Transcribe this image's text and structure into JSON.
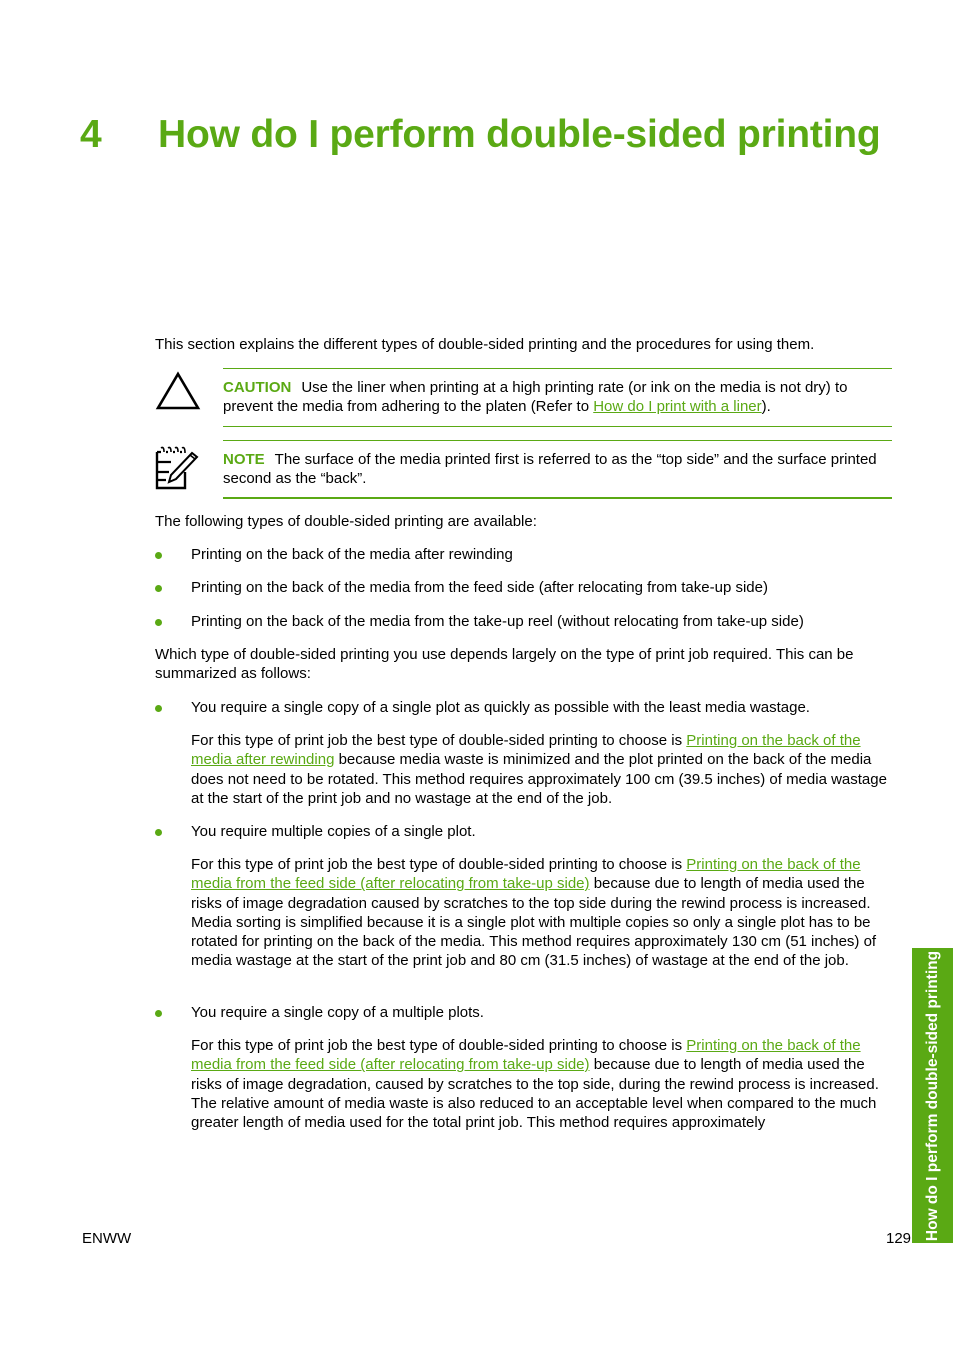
{
  "chapter": {
    "number": "4",
    "title": "How do I perform double-sided printing"
  },
  "intro": "This section explains the different types of double-sided printing and the procedures for using them.",
  "caution": {
    "icon": "caution-triangle-icon",
    "label": "CAUTION",
    "text_before": "Use the liner when printing at a high printing rate (or ink on the media is not dry) to prevent the media from adhering to the platen (Refer to ",
    "link": "How do I print with a liner",
    "text_after": ")."
  },
  "note": {
    "icon": "note-pencil-icon",
    "label": "NOTE",
    "text": "The surface of the media printed first is referred to as the “top side” and the surface printed second as the “back”."
  },
  "types_intro": "The following types of double-sided printing are available:",
  "types": [
    "Printing on the back of the media after rewinding",
    "Printing on the back of the media from the feed side (after relocating from take-up side)",
    "Printing on the back of the media from the take-up reel (without relocating from take-up side)"
  ],
  "summary_intro": "Which type of double-sided printing you use depends largely on the type of print job required. This can be summarized as follows:",
  "cases": [
    {
      "bullet": "You require a single copy of a single plot as quickly as possible with the least media wastage.",
      "text_before": "For this type of print job the best type of double-sided printing to choose is ",
      "link": "Printing on the back of the media after rewinding",
      "text_after": " because media waste is minimized and the plot printed on the back of the media does not need to be rotated. This method requires approximately 100 cm (39.5 inches) of media wastage at the start of the print job and no wastage at the end of the job."
    },
    {
      "bullet": "You require multiple copies of a single plot.",
      "text_before": "For this type of print job the best type of double-sided printing to choose is ",
      "link": "Printing on the back of the media from the feed side (after relocating from take-up side)",
      "text_after": " because due to length of media used the risks of image degradation caused by scratches to the top side during the rewind process is increased. Media sorting is simplified because it is a single plot with multiple copies so only a single plot has to be rotated for printing on the back of the media. This method requires approximately 130 cm (51 inches) of media wastage at the start of the print job and 80 cm (31.5 inches) of wastage at the end of the job."
    },
    {
      "bullet": "You require a single copy of a multiple plots.",
      "text_before": "For this type of print job the best type of double-sided printing to choose is ",
      "link": "Printing on the back of the media from the feed side (after relocating from take-up side)",
      "text_after": " because due to length of media used the risks of image degradation, caused by scratches to the top side, during the rewind process is increased. The relative amount of media waste is also reduced to an acceptable level when compared to the much greater length of media used for the total print job. This method requires approximately"
    }
  ],
  "side_tab": "How do I perform double-sided printing",
  "footer": {
    "left": "ENWW",
    "page": "129"
  },
  "colors": {
    "accent": "#5aa914",
    "text": "#000000"
  }
}
